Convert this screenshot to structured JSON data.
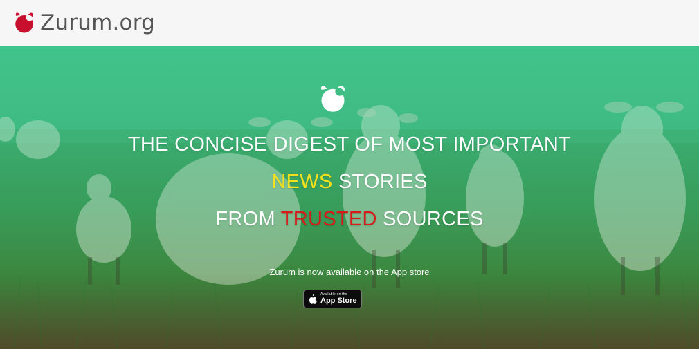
{
  "brand": {
    "name": "Zurum.org",
    "logo_icon": "zurum-sheep-icon",
    "logo_color": "#c8102e"
  },
  "hero": {
    "background_icon": "sheep-meadow-photo",
    "logo_icon": "zurum-sheep-icon",
    "headline": {
      "line1": "THE CONCISE DIGEST OF MOST IMPORTANT",
      "line2_highlight": "NEWS",
      "line2_rest": " STORIES",
      "line3_start": "FROM ",
      "line3_highlight": "TRUSTED",
      "line3_end": " SOURCES"
    },
    "colors": {
      "text": "#ffffff",
      "highlight_yellow": "#f2e21e",
      "highlight_red": "#d61b1b"
    },
    "app_note": "Zurum is now available on the App store",
    "app_store_badge": {
      "small_text": "Available on the",
      "big_text": "App Store",
      "icon": "apple-icon"
    }
  }
}
